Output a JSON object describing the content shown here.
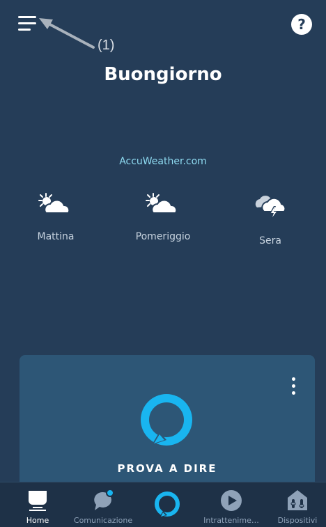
{
  "header": {
    "menu_icon": "hamburger-menu-icon",
    "help_icon": "help-icon",
    "help_symbol": "?",
    "annotation_label": "(1)"
  },
  "greeting": "Buongiorno",
  "weather": {
    "source": "AccuWeather.com",
    "periods": [
      {
        "label": "Mattina",
        "icon": "partly-sunny-icon"
      },
      {
        "label": "Pomeriggio",
        "icon": "partly-sunny-icon"
      },
      {
        "label": "Sera",
        "icon": "thunderstorm-icon"
      }
    ]
  },
  "card": {
    "title": "PROVA A DIRE",
    "menu_icon": "more-options-icon",
    "logo_icon": "alexa-ring-icon"
  },
  "bottom_nav": {
    "items": [
      {
        "label": "Home",
        "icon": "home-icon",
        "active": true
      },
      {
        "label": "Comunicazione",
        "icon": "chat-bubble-icon",
        "active": false
      },
      {
        "label": "",
        "icon": "alexa-button-icon",
        "active": false
      },
      {
        "label": "Intrattenime…",
        "icon": "play-icon",
        "active": false
      },
      {
        "label": "Dispositivi",
        "icon": "devices-icon",
        "active": false
      }
    ]
  },
  "colors": {
    "background": "#253d58",
    "card": "#2d5676",
    "accent": "#19b5f0",
    "link": "#8fdcf2"
  }
}
